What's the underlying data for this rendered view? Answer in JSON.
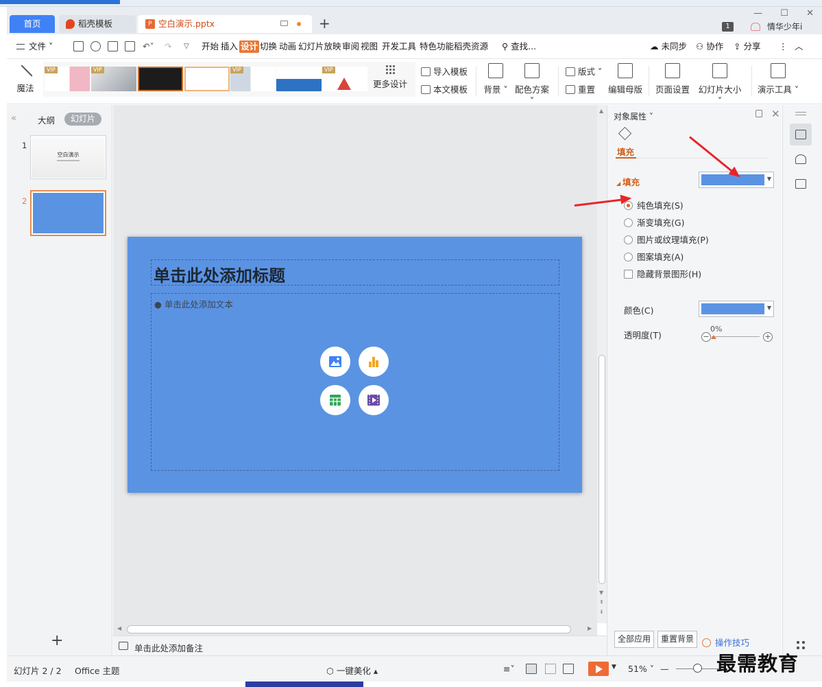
{
  "tabs": {
    "home": "首页",
    "template": "稻壳模板",
    "doc": "空白演示.pptx",
    "new_tab": "+"
  },
  "titlebar": {
    "page_badge": "1",
    "user_name": "情华少年i",
    "controls": [
      "—",
      "☐",
      "✕"
    ]
  },
  "menubar": {
    "file": "文件",
    "items": [
      "开始",
      "插入",
      "设计",
      "切换",
      "动画",
      "幻灯片放映",
      "审阅",
      "视图",
      "开发工具",
      "特色功能",
      "稻壳资源"
    ],
    "active": "设计",
    "search": "查找...",
    "sync": "未同步",
    "collaborate": "协作",
    "share": "分享"
  },
  "ribbon": {
    "magic": "魔法",
    "more_design": "更多设计",
    "import_template": "导入模板",
    "text_template": "本文模板",
    "background": "背景",
    "color_scheme": "配色方案",
    "layout": "版式",
    "reset": "重置",
    "edit_master": "编辑母版",
    "page_setup": "页面设置",
    "slide_size": "幻灯片大小",
    "presentation_tools": "演示工具",
    "vip": "VIP"
  },
  "left_panel": {
    "outline": "大纲",
    "slides": "幻灯片",
    "slide1_title": "空白演示",
    "slide_numbers": [
      "1",
      "2"
    ],
    "add": "+"
  },
  "slide": {
    "title_placeholder": "单击此处添加标题",
    "body_placeholder": "单击此处添加文本",
    "background_color": "#5b93e3"
  },
  "notes": {
    "placeholder": "单击此处添加备注"
  },
  "properties": {
    "panel_title": "对象属性",
    "tab_fill": "填充",
    "section_fill": "填充",
    "options": [
      "纯色填充(S)",
      "渐变填充(G)",
      "图片或纹理填充(P)",
      "图案填充(A)"
    ],
    "selected_option": "纯色填充(S)",
    "hide_bg_shapes": "隐藏背景图形(H)",
    "color_label": "颜色(C)",
    "transparency_label": "透明度(T)",
    "transparency_value": "0%",
    "apply_all": "全部应用",
    "reset_bg": "重置背景",
    "tips": "操作技巧"
  },
  "statusbar": {
    "slide_info": "幻灯片 2 / 2",
    "theme": "Office 主题",
    "beautify": "一键美化",
    "zoom": "51%"
  },
  "watermark": "最需教育",
  "colors": {
    "accent": "#e87837",
    "slide_fill": "#5b93e3",
    "tab_active": "#3f82f5",
    "arrow": "#e8252b"
  }
}
